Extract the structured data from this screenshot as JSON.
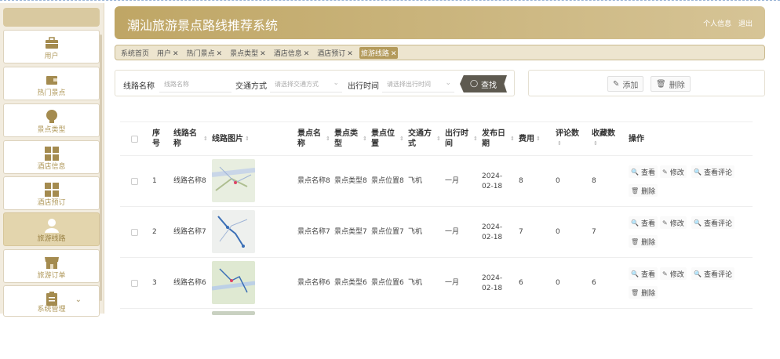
{
  "header": {
    "title": "潮汕旅游景点路线推荐系统",
    "profile": "个人信息",
    "logout": "退出"
  },
  "sidebar": {
    "items": [
      {
        "label": "用户",
        "icon": "briefcase-icon"
      },
      {
        "label": "热门景点",
        "icon": "wallet-icon"
      },
      {
        "label": "景点类型",
        "icon": "bulb-icon"
      },
      {
        "label": "酒店信息",
        "icon": "grid-icon"
      },
      {
        "label": "酒店预订",
        "icon": "grid-icon"
      },
      {
        "label": "旅游线路",
        "icon": "user-icon",
        "active": true
      },
      {
        "label": "旅游订单",
        "icon": "shop-icon"
      },
      {
        "label": "系统管理",
        "icon": "clipboard-icon"
      }
    ]
  },
  "tabs": [
    "系统首页",
    "用户",
    "热门景点",
    "景点类型",
    "酒店信息",
    "酒店预订",
    "旅游线路"
  ],
  "search": {
    "route_label": "线路名称",
    "route_placeholder": "线路名称",
    "transport_label": "交通方式",
    "transport_placeholder": "请选择交通方式",
    "time_label": "出行时间",
    "time_placeholder": "请选择出行时间",
    "find": "查找"
  },
  "actions": {
    "add": "添加",
    "delete": "删除"
  },
  "table": {
    "headers": {
      "index": "序号",
      "name": "线路名称",
      "image": "线路图片",
      "spot_name": "景点名称",
      "spot_type": "景点类型",
      "spot_loc": "景点位置",
      "transport": "交通方式",
      "travel_time": "出行时间",
      "date": "发布日期",
      "cost": "费用",
      "comments": "评论数",
      "favorites": "收藏数",
      "ops": "操作"
    },
    "ops": {
      "view": "查看",
      "edit": "修改",
      "view_comments": "查看评论",
      "delete": "删除"
    },
    "rows": [
      {
        "index": "1",
        "name": "线路名称8",
        "spot_name": "景点名称8",
        "spot_type": "景点类型8",
        "spot_loc": "景点位置8",
        "transport": "飞机",
        "travel_time": "一月",
        "date": "2024-02-18",
        "cost": "8",
        "comments": "0",
        "favorites": "8"
      },
      {
        "index": "2",
        "name": "线路名称7",
        "spot_name": "景点名称7",
        "spot_type": "景点类型7",
        "spot_loc": "景点位置7",
        "transport": "飞机",
        "travel_time": "一月",
        "date": "2024-02-18",
        "cost": "7",
        "comments": "0",
        "favorites": "7"
      },
      {
        "index": "3",
        "name": "线路名称6",
        "spot_name": "景点名称6",
        "spot_type": "景点类型6",
        "spot_loc": "景点位置6",
        "transport": "飞机",
        "travel_time": "一月",
        "date": "2024-02-18",
        "cost": "6",
        "comments": "0",
        "favorites": "6"
      }
    ]
  },
  "colors": {
    "brand": "#bfa665",
    "sidebar_bg": "#f2ecdf",
    "find_button": "#5e5a50"
  }
}
